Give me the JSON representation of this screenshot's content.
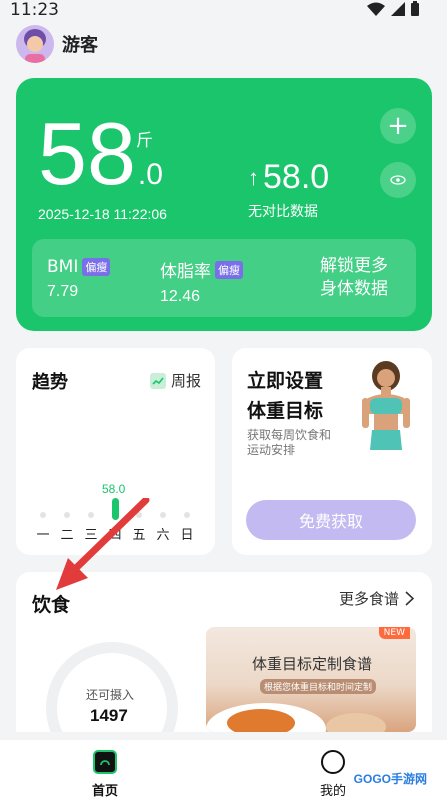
{
  "status_bar": {
    "time": "11:23"
  },
  "header": {
    "username": "游客"
  },
  "weight_card": {
    "weight_integer": "58",
    "weight_decimal": ".0",
    "unit": "斤",
    "date": "2025-12-18 11:22:06",
    "compare_value": "58.0",
    "compare_label": "无对比数据",
    "bmi": {
      "label": "BMI",
      "badge": "偏瘦",
      "value": "7.79"
    },
    "body_fat": {
      "label": "体脂率",
      "badge": "偏瘦",
      "value": "12.46"
    },
    "unlock_line1": "解锁更多",
    "unlock_line2": "身体数据",
    "accent": "#1ac56b"
  },
  "trend_card": {
    "title": "趋势",
    "weekly_label": "周报",
    "days": [
      "一",
      "二",
      "三",
      "四",
      "五",
      "六",
      "日"
    ],
    "bar_value": "58.0"
  },
  "goal_card": {
    "title_line1": "立即设置",
    "title_line2": "体重目标",
    "sub_line1": "获取每周饮食和",
    "sub_line2": "运动安排",
    "button": "免费获取"
  },
  "diet_card": {
    "title": "饮食",
    "more_label": "更多食谱",
    "remain_label": "还可摄入",
    "remain_value": "1497",
    "recipe_title": "体重目标定制食谱",
    "recipe_sub": "根据您体重目标和时间定制",
    "new_badge": "NEW"
  },
  "tabbar": {
    "home": "首页",
    "mine": "我的"
  },
  "watermark": "GOGO手游网"
}
